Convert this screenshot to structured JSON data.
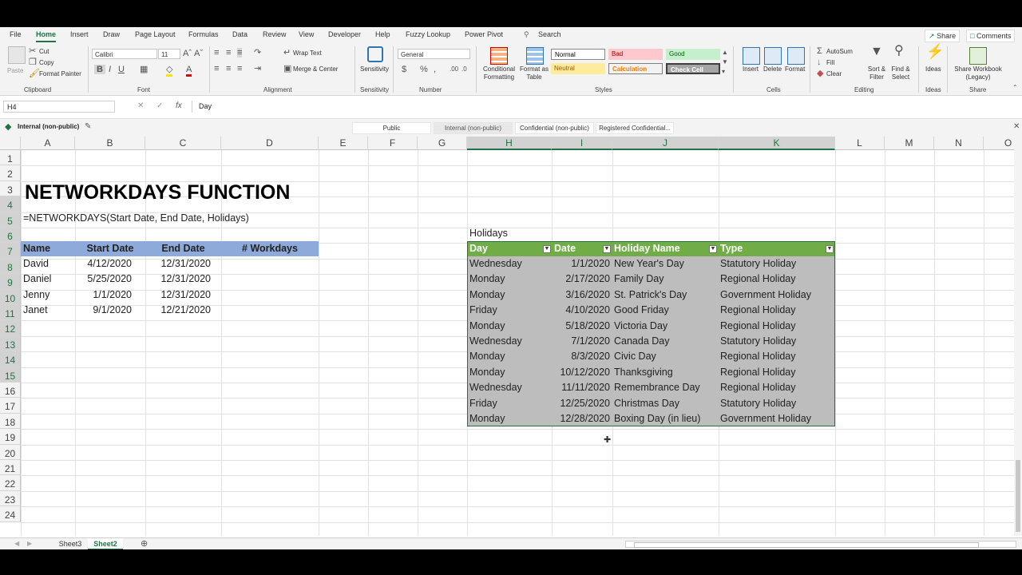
{
  "menu": {
    "tabs": [
      "File",
      "Home",
      "Insert",
      "Draw",
      "Page Layout",
      "Formulas",
      "Data",
      "Review",
      "View",
      "Developer",
      "Help",
      "Fuzzy Lookup",
      "Power Pivot"
    ],
    "search": "Search",
    "share": "Share",
    "comments": "Comments"
  },
  "ribbon": {
    "clipboard": {
      "paste": "Paste",
      "cut": "Cut",
      "copy": "Copy",
      "format_painter": "Format Painter",
      "label": "Clipboard"
    },
    "font": {
      "name": "Calibri",
      "size": "11",
      "label": "Font"
    },
    "alignment": {
      "wrap": "Wrap Text",
      "merge": "Merge & Center",
      "label": "Alignment"
    },
    "sensitivity": {
      "button": "Sensitivity",
      "label": "Sensitivity"
    },
    "number": {
      "format": "General",
      "label": "Number"
    },
    "styles": {
      "conditional": "Conditional Formatting",
      "format_table": "Format as Table",
      "normal": "Normal",
      "bad": "Bad",
      "good": "Good",
      "neutral": "Neutral",
      "calculation": "Calculation",
      "check_cell": "Check Cell",
      "label": "Styles"
    },
    "cells": {
      "insert": "Insert",
      "delete": "Delete",
      "format": "Format",
      "label": "Cells"
    },
    "editing": {
      "autosum": "AutoSum",
      "fill": "Fill",
      "clear": "Clear",
      "sort": "Sort & Filter",
      "find": "Find & Select",
      "label": "Editing"
    },
    "ideas": {
      "button": "Ideas",
      "label": "Ideas"
    },
    "share_group": {
      "button": "Share Workbook (Legacy)",
      "label": "Share"
    }
  },
  "formula_bar": {
    "name_box": "H4",
    "content": "Day"
  },
  "sensitivity_bar": {
    "label": "Internal (non-public)",
    "options": [
      "Public",
      "Internal (non-public)",
      "Confidential (non-public)",
      "Registered Confidential..."
    ]
  },
  "columns": [
    "A",
    "B",
    "C",
    "D",
    "E",
    "F",
    "G",
    "H",
    "I",
    "J",
    "K",
    "L",
    "M",
    "N",
    "O"
  ],
  "rows": [
    "1",
    "2",
    "3",
    "4",
    "5",
    "6",
    "7",
    "8",
    "9",
    "10",
    "11",
    "12",
    "13",
    "14",
    "15",
    "16",
    "17",
    "18",
    "19",
    "20",
    "21",
    "22",
    "23",
    "24"
  ],
  "sheet": {
    "title": "NETWORKDAYS FUNCTION",
    "syntax": "=NETWORKDAYS(Start Date, End Date, Holidays)",
    "left_headers": [
      "Name",
      "Start Date",
      "End Date",
      "# Workdays"
    ],
    "left_rows": [
      [
        "David",
        "4/12/2020",
        "12/31/2020"
      ],
      [
        "Daniel",
        "5/25/2020",
        "12/31/2020"
      ],
      [
        "Jenny",
        "1/1/2020",
        "12/31/2020"
      ],
      [
        "Janet",
        "9/1/2020",
        "12/21/2020"
      ]
    ],
    "holidays_label": "Holidays",
    "holiday_headers": [
      "Day",
      "Date",
      "Holiday Name",
      "Type"
    ],
    "holiday_rows": [
      [
        "Wednesday",
        "1/1/2020",
        "New Year's Day",
        "Statutory Holiday"
      ],
      [
        "Monday",
        "2/17/2020",
        "Family Day",
        "Regional Holiday"
      ],
      [
        "Monday",
        "3/16/2020",
        "St. Patrick's Day",
        "Government Holiday"
      ],
      [
        "Friday",
        "4/10/2020",
        "Good Friday",
        "Regional Holiday"
      ],
      [
        "Monday",
        "5/18/2020",
        "Victoria Day",
        "Regional Holiday"
      ],
      [
        "Wednesday",
        "7/1/2020",
        "Canada Day",
        "Statutory Holiday"
      ],
      [
        "Monday",
        "8/3/2020",
        "Civic Day",
        "Regional Holiday"
      ],
      [
        "Monday",
        "10/12/2020",
        "Thanksgiving",
        "Regional Holiday"
      ],
      [
        "Wednesday",
        "11/11/2020",
        "Remembrance Day",
        "Regional Holiday"
      ],
      [
        "Friday",
        "12/25/2020",
        "Christmas Day",
        "Statutory Holiday"
      ],
      [
        "Monday",
        "12/28/2020",
        "Boxing Day (in lieu)",
        "Government Holiday"
      ]
    ]
  },
  "sheet_tabs": [
    "Sheet3",
    "Sheet2"
  ],
  "active_sheet": "Sheet2",
  "colors": {
    "accent": "#217346",
    "header_blue": "#8eaadb",
    "table_green": "#70ad47",
    "table_gray": "#bdbdbd"
  }
}
